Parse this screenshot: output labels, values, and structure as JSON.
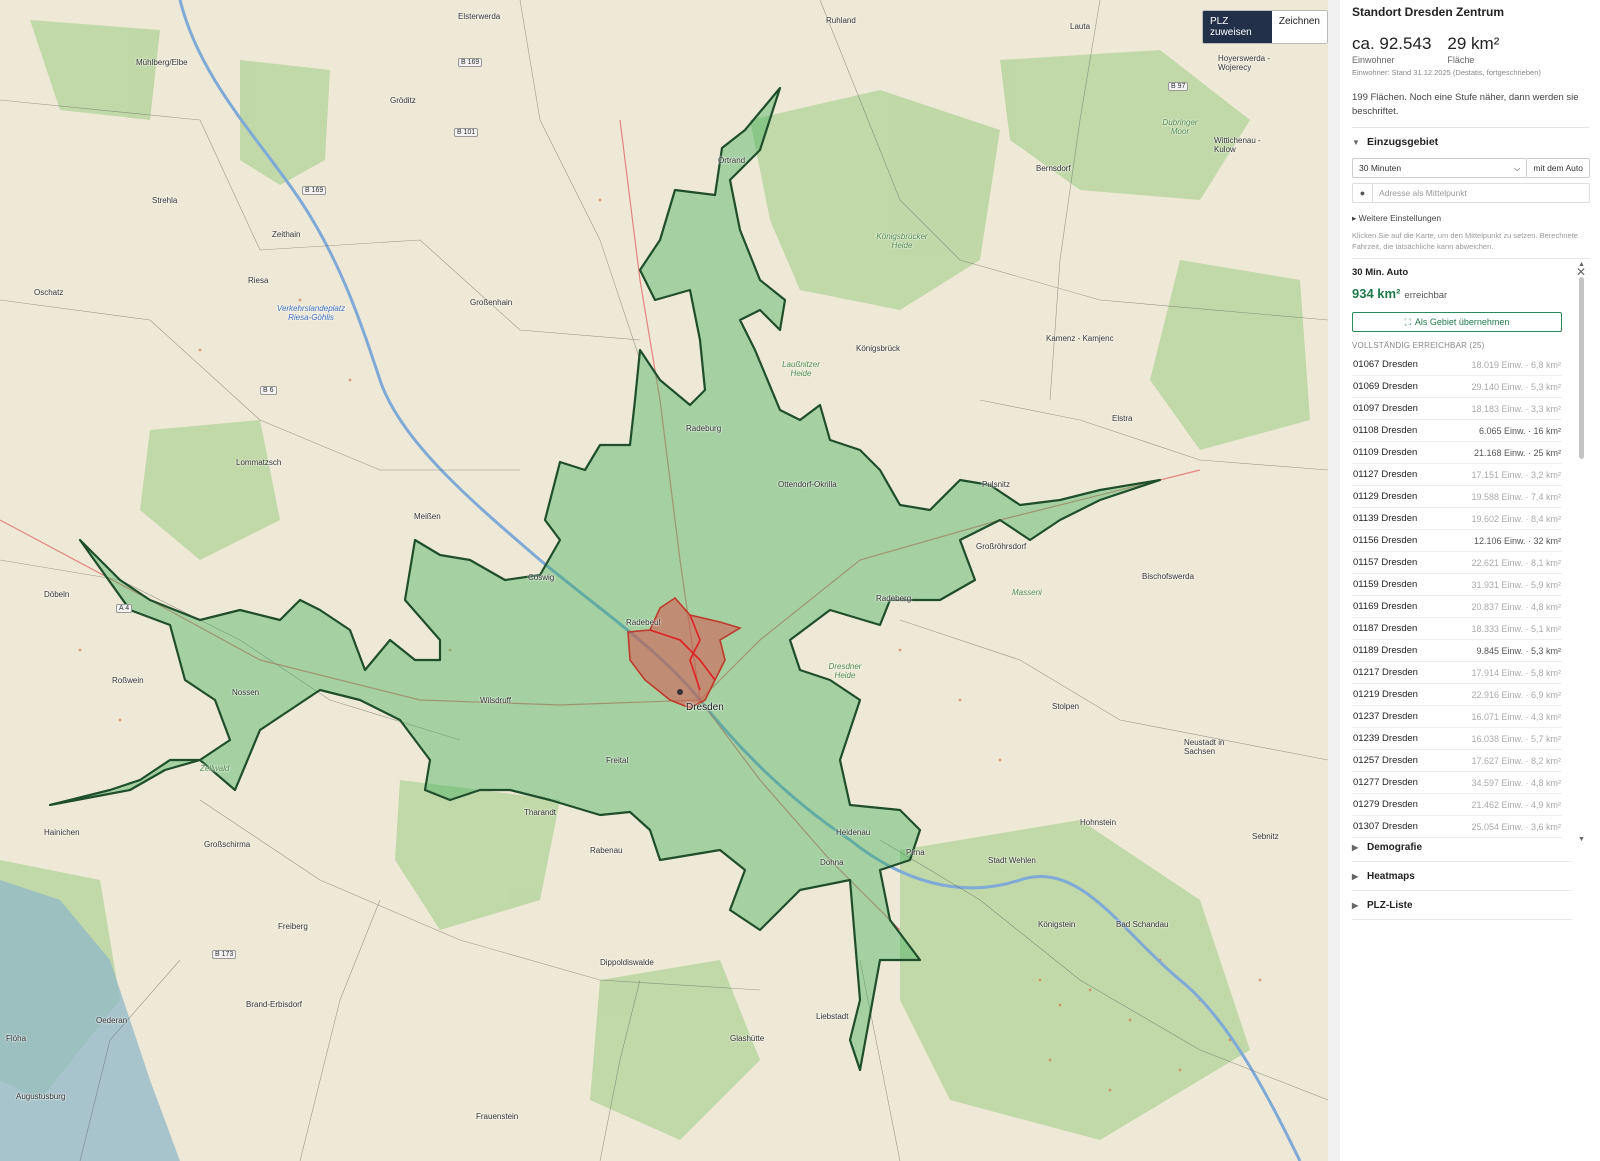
{
  "map": {
    "controls": {
      "assign_label": "PLZ zuweisen",
      "draw_label": "Zeichnen"
    },
    "places": [
      {
        "name": "Elsterwerda"
      },
      {
        "name": "Ruhland"
      },
      {
        "name": "Lauta"
      },
      {
        "name": "Hoyerswerda - Wojerecy"
      },
      {
        "name": "Mühlberg/Elbe"
      },
      {
        "name": "Gröditz"
      },
      {
        "name": "Ortrand"
      },
      {
        "name": "Bernsdorf"
      },
      {
        "name": "Wittichenau - Kulow"
      },
      {
        "name": "Strehla"
      },
      {
        "name": "Zeithain"
      },
      {
        "name": "Riesa"
      },
      {
        "name": "Oschatz"
      },
      {
        "name": "Großenhain"
      },
      {
        "name": "Königsbrück"
      },
      {
        "name": "Kamenz - Kamjenc"
      },
      {
        "name": "Elstra"
      },
      {
        "name": "Radeburg"
      },
      {
        "name": "Lommatzsch"
      },
      {
        "name": "Ottendorf-Okrilla"
      },
      {
        "name": "Pulsnitz"
      },
      {
        "name": "Meißen"
      },
      {
        "name": "Großröhrsdorf"
      },
      {
        "name": "Coswig"
      },
      {
        "name": "Bischofswerda"
      },
      {
        "name": "Döbeln"
      },
      {
        "name": "Radeberg"
      },
      {
        "name": "Radebeul"
      },
      {
        "name": "Roßwein"
      },
      {
        "name": "Nossen"
      },
      {
        "name": "Wilsdruff"
      },
      {
        "name": "Dresden"
      },
      {
        "name": "Stolpen"
      },
      {
        "name": "Neustadt in Sachsen"
      },
      {
        "name": "Freital"
      },
      {
        "name": "Tharandt"
      },
      {
        "name": "Hainichen"
      },
      {
        "name": "Großschirma"
      },
      {
        "name": "Rabenau"
      },
      {
        "name": "Heidenau"
      },
      {
        "name": "Pirna"
      },
      {
        "name": "Hohnstein"
      },
      {
        "name": "Sebnitz"
      },
      {
        "name": "Dohna"
      },
      {
        "name": "Stadt Wehlen"
      },
      {
        "name": "Freiberg"
      },
      {
        "name": "Königstein"
      },
      {
        "name": "Bad Schandau"
      },
      {
        "name": "Dippoldiswalde"
      },
      {
        "name": "Brand-Erbisdorf"
      },
      {
        "name": "Oederan"
      },
      {
        "name": "Flöha"
      },
      {
        "name": "Liebstadt"
      },
      {
        "name": "Glashütte"
      },
      {
        "name": "Augustusburg"
      },
      {
        "name": "Frauenstein"
      }
    ],
    "areas": [
      {
        "name": "Verkehrslandeplatz Riesa-Göhlis"
      },
      {
        "name": "Königsbrücker Heide"
      },
      {
        "name": "Dresdner Heide"
      },
      {
        "name": "Dubringer Moor"
      },
      {
        "name": "Zellwald"
      },
      {
        "name": "Laußnitzer Heide"
      },
      {
        "name": "Masseni"
      }
    ],
    "roads": [
      "B 169",
      "B 101",
      "B 169",
      "B 97",
      "B 6",
      "A 4",
      "B 173"
    ]
  },
  "sidebar": {
    "title": "Standort Dresden Zentrum",
    "population": {
      "value": "ca. 92.543",
      "label": "Einwohner"
    },
    "area": {
      "value": "29 km²",
      "label": "Fläche"
    },
    "source_note": "Einwohner: Stand 31.12.2025 (Destatis, fortgeschrieben)",
    "info": "199 Flächen. Noch eine Stufe näher, dann werden sie beschriftet.",
    "catchment": {
      "title": "Einzugsgebiet",
      "time_value": "30 Minuten",
      "mode_label": "mit dem Auto",
      "address_placeholder": "Adresse als Mittelpunkt",
      "more_settings": "▸ Weitere Einstellungen",
      "hint": "Klicken Sie auf die Karte, um den Mittelpunkt zu setzen. Berechnete Fahrzeit, die tatsächliche kann abweichen."
    },
    "result": {
      "title": "30 Min. Auto",
      "area_value": "934 km²",
      "area_suffix": "erreichbar",
      "adopt_label": "Als Gebiet übernehmen",
      "list_header": "VOLLSTÄNDIG ERREICHBAR (25)",
      "rows": [
        {
          "plz": "01067 Dresden",
          "meta": "18.019 Einw. · 6,8 km²"
        },
        {
          "plz": "01069 Dresden",
          "meta": "29.140 Einw. · 5,3 km²"
        },
        {
          "plz": "01097 Dresden",
          "meta": "18.183 Einw. · 3,3 km²"
        },
        {
          "plz": "01108 Dresden",
          "meta": "6.065 Einw. · 16 km²"
        },
        {
          "plz": "01109 Dresden",
          "meta": "21.168 Einw. · 25 km²"
        },
        {
          "plz": "01127 Dresden",
          "meta": "17.151 Einw. · 3,2 km²"
        },
        {
          "plz": "01129 Dresden",
          "meta": "19.588 Einw. · 7,4 km²"
        },
        {
          "plz": "01139 Dresden",
          "meta": "19.602 Einw. · 8,4 km²"
        },
        {
          "plz": "01156 Dresden",
          "meta": "12.106 Einw. · 32 km²"
        },
        {
          "plz": "01157 Dresden",
          "meta": "22.621 Einw. · 8,1 km²"
        },
        {
          "plz": "01159 Dresden",
          "meta": "31.931 Einw. · 5,9 km²"
        },
        {
          "plz": "01169 Dresden",
          "meta": "20.837 Einw. · 4,8 km²"
        },
        {
          "plz": "01187 Dresden",
          "meta": "18.333 Einw. · 5,1 km²"
        },
        {
          "plz": "01189 Dresden",
          "meta": "9.845 Einw. · 5,3 km²"
        },
        {
          "plz": "01217 Dresden",
          "meta": "17.914 Einw. · 5,8 km²"
        },
        {
          "plz": "01219 Dresden",
          "meta": "22.916 Einw. · 6,9 km²"
        },
        {
          "plz": "01237 Dresden",
          "meta": "16.071 Einw. · 4,3 km²"
        },
        {
          "plz": "01239 Dresden",
          "meta": "16.038 Einw. · 5,7 km²"
        },
        {
          "plz": "01257 Dresden",
          "meta": "17.627 Einw. · 8,2 km²"
        },
        {
          "plz": "01277 Dresden",
          "meta": "34.597 Einw. · 4,8 km²"
        },
        {
          "plz": "01279 Dresden",
          "meta": "21.462 Einw. · 4,9 km²"
        },
        {
          "plz": "01307 Dresden",
          "meta": "25.054 Einw. · 3,6 km²"
        }
      ]
    },
    "sections": [
      {
        "label": "Demografie"
      },
      {
        "label": "Heatmaps"
      },
      {
        "label": "PLZ-Liste"
      }
    ]
  },
  "colors": {
    "accent_green": "#1f7a4a",
    "catchment_fill": "#3fae5a",
    "center_red": "#d9534f",
    "active_button": "#22304a"
  }
}
